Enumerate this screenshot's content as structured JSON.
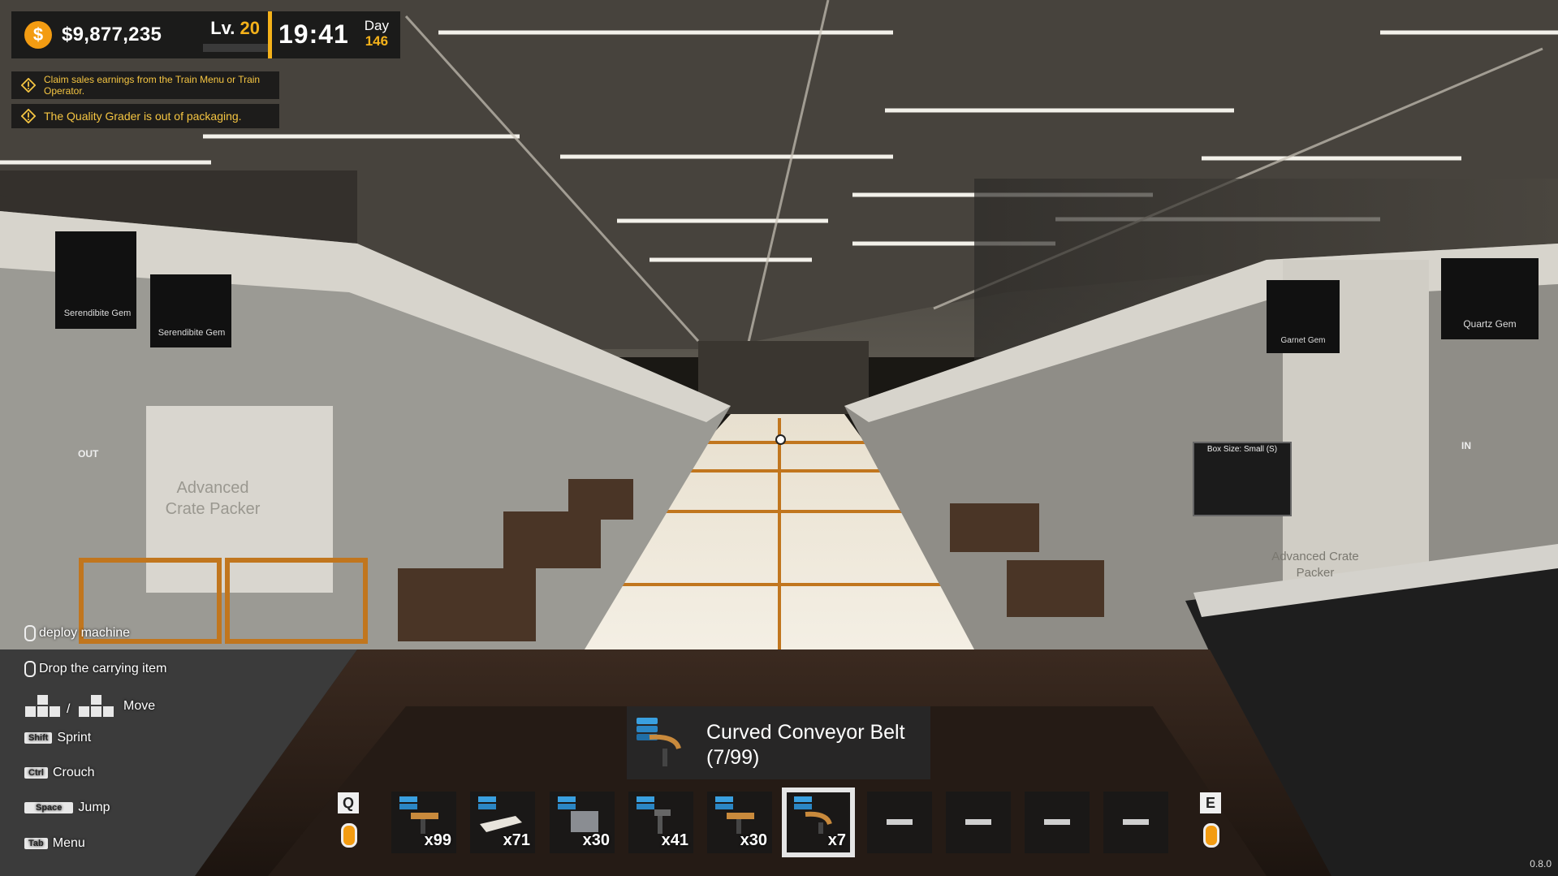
{
  "hud": {
    "money": "$9,877,235",
    "coin_symbol": "$",
    "level_prefix": "Lv.",
    "level": "20",
    "time": "19:41",
    "day_label": "Day",
    "day": "146",
    "accent_color": "#f5b21a"
  },
  "notifications": [
    "Claim sales earnings from the Train Menu or Train Operator.",
    "The Quality Grader is out of packaging."
  ],
  "world_labels": {
    "left_machine": "Advanced Crate Packer",
    "right_machine": "Advanced Crate Packer",
    "sign_serendibite_1": "Serendibite Gem",
    "sign_serendibite_2": "Serendibite Gem",
    "sign_quartz": "Quartz Gem",
    "sign_garnet": "Garnet Gem",
    "box_size": "Box Size: Small (S)",
    "out_label": "OUT",
    "in_label": "IN"
  },
  "controls": [
    {
      "key": "",
      "label": "deploy machine",
      "icon": "mouse-left-icon"
    },
    {
      "key": "",
      "label": "Drop the carrying item",
      "icon": "mouse-right-icon"
    },
    {
      "key": "W A S D / Arrows",
      "label": "Move",
      "icon": "keys-icon"
    },
    {
      "key": "Shift",
      "label": "Sprint"
    },
    {
      "key": "Ctrl",
      "label": "Crouch"
    },
    {
      "key": "Space",
      "label": "Jump"
    },
    {
      "key": "Tab",
      "label": "Menu"
    }
  ],
  "tooltip": {
    "name": "Curved Conveyor Belt",
    "count": "(7/99)"
  },
  "hotbar": {
    "prev_key": "Q",
    "next_key": "E",
    "slots": [
      {
        "count": "x99",
        "icon": "conveyor-icon"
      },
      {
        "count": "x71",
        "icon": "roller-conveyor-icon"
      },
      {
        "count": "x30",
        "icon": "machine-icon"
      },
      {
        "count": "x41",
        "icon": "stand-icon"
      },
      {
        "count": "x30",
        "icon": "conveyor-icon"
      },
      {
        "count": "x7",
        "icon": "curved-conveyor-icon",
        "selected": true
      },
      {
        "count": "",
        "icon": "empty"
      },
      {
        "count": "",
        "icon": "empty"
      },
      {
        "count": "",
        "icon": "empty"
      },
      {
        "count": "",
        "icon": "empty"
      }
    ]
  },
  "version": "0.8.0"
}
